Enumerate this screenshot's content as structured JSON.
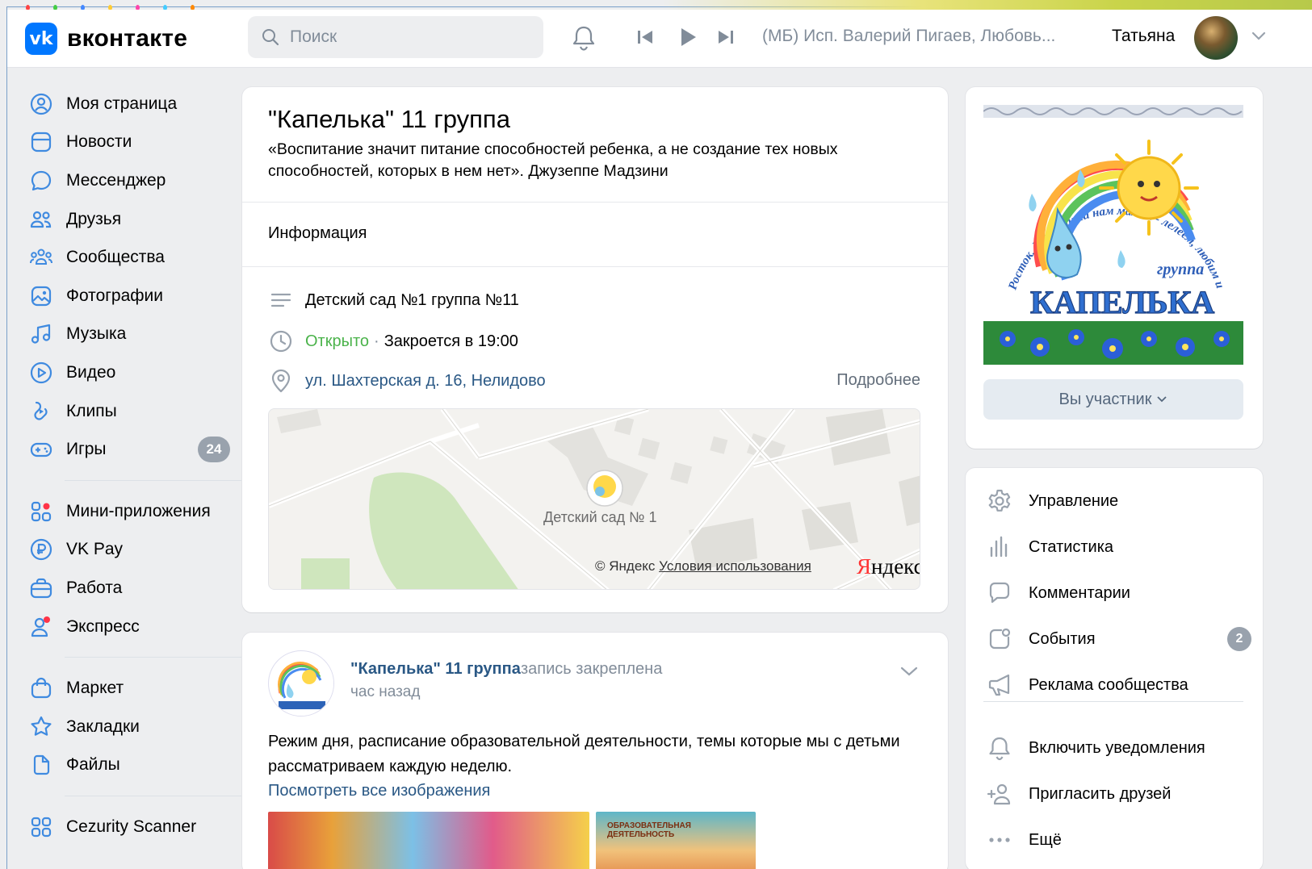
{
  "header": {
    "logo_text": "вконтакте",
    "logo_mark": "vk",
    "search_placeholder": "Поиск",
    "now_playing": "(МБ) Исп. Валерий Пигаев, Любовь...",
    "user_name": "Татьяна"
  },
  "sidebar": {
    "items": [
      {
        "label": "Моя страница",
        "icon": "user-circle-icon"
      },
      {
        "label": "Новости",
        "icon": "news-icon"
      },
      {
        "label": "Мессенджер",
        "icon": "message-icon"
      },
      {
        "label": "Друзья",
        "icon": "friends-icon"
      },
      {
        "label": "Сообщества",
        "icon": "communities-icon"
      },
      {
        "label": "Фотографии",
        "icon": "photo-icon"
      },
      {
        "label": "Музыка",
        "icon": "music-icon"
      },
      {
        "label": "Видео",
        "icon": "video-icon"
      },
      {
        "label": "Клипы",
        "icon": "clips-icon"
      },
      {
        "label": "Игры",
        "icon": "games-icon",
        "badge": "24"
      }
    ],
    "items2": [
      {
        "label": "Мини-приложения",
        "icon": "apps-icon"
      },
      {
        "label": "VK Pay",
        "icon": "vkpay-icon"
      },
      {
        "label": "Работа",
        "icon": "work-icon"
      },
      {
        "label": "Экспресс",
        "icon": "express-icon"
      }
    ],
    "items3": [
      {
        "label": "Маркет",
        "icon": "market-icon"
      },
      {
        "label": "Закладки",
        "icon": "bookmark-icon"
      },
      {
        "label": "Файлы",
        "icon": "file-icon"
      }
    ],
    "items4": [
      {
        "label": "Cezurity Scanner",
        "icon": "apps-icon"
      }
    ]
  },
  "group": {
    "title": "\"Капелька\" 11 группа",
    "description": "«Воспитание значит питание способностей ребенка, а не создание тех новых способностей, которых в нем нет». Джузеппе Мадзини",
    "info_label": "Информация",
    "org_name": "Детский сад №1 группа №11",
    "open_status": "Открыто",
    "closes_text": "Закроется в 19:00",
    "address": "ул. Шахтерская д. 16, Нелидово",
    "more_link": "Подробнее",
    "map_place_label": "Детский сад № 1",
    "map_copyright": "© Яндекс",
    "map_terms": "Условия использования",
    "map_brand_first": "Я",
    "map_brand_rest": "ндекс"
  },
  "post": {
    "author": "\"Капелька\" 11 группа",
    "pinned_text": "запись закреплена",
    "time": "час назад",
    "text": "Режим дня, расписание образовательной деятельности, темы которые мы с детьми рассматриваем каждую неделю.",
    "view_all_link": "Посмотреть все изображения",
    "image2_caption": "ОБРАЗОВАТЕЛЬНАЯ ДЕЯТЕЛЬНОСТЬ"
  },
  "cover": {
    "ring_text": "Росток, доверенный нам мамой - лелеем, любим и растим!",
    "group_word": "группа",
    "title_word": "КАПЕЛЬКА",
    "member_button": "Вы участник"
  },
  "right_menu": {
    "items": [
      {
        "label": "Управление",
        "icon": "gear-icon"
      },
      {
        "label": "Статистика",
        "icon": "stats-icon"
      },
      {
        "label": "Комментарии",
        "icon": "comment-icon"
      },
      {
        "label": "События",
        "icon": "events-icon",
        "badge": "2"
      },
      {
        "label": "Реклама сообщества",
        "icon": "ads-icon"
      }
    ],
    "items2": [
      {
        "label": "Включить уведомления",
        "icon": "bell-icon"
      },
      {
        "label": "Пригласить друзей",
        "icon": "invite-icon"
      },
      {
        "label": "Ещё",
        "icon": "more-icon"
      }
    ]
  },
  "colors": {
    "accent": "#0077ff",
    "link": "#2a5885",
    "open_green": "#4bb34b",
    "secondary_text": "#818c99",
    "icon_blue": "#3f8ae0"
  }
}
